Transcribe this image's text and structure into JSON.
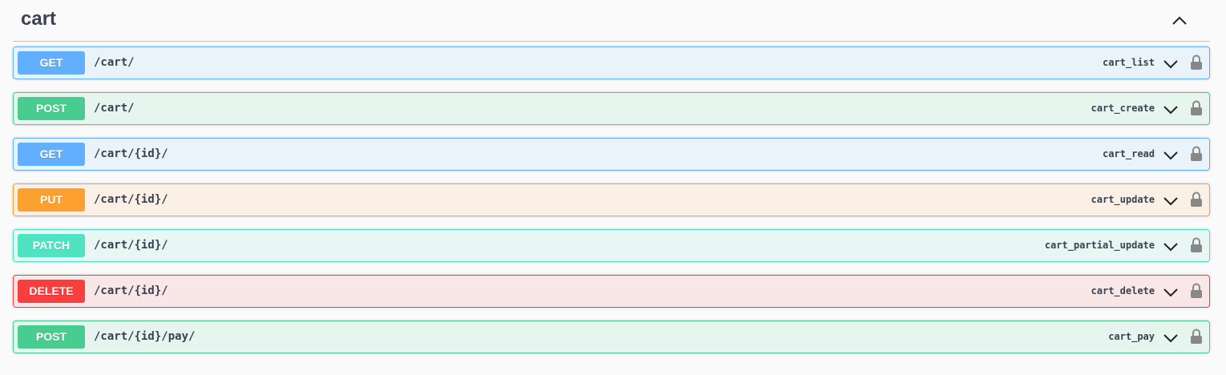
{
  "section": {
    "title": "cart"
  },
  "operations": [
    {
      "method": "GET",
      "path": "/cart/",
      "operation_id": "cart_list"
    },
    {
      "method": "POST",
      "path": "/cart/",
      "operation_id": "cart_create"
    },
    {
      "method": "GET",
      "path": "/cart/{id}/",
      "operation_id": "cart_read"
    },
    {
      "method": "PUT",
      "path": "/cart/{id}/",
      "operation_id": "cart_update"
    },
    {
      "method": "PATCH",
      "path": "/cart/{id}/",
      "operation_id": "cart_partial_update"
    },
    {
      "method": "DELETE",
      "path": "/cart/{id}/",
      "operation_id": "cart_delete"
    },
    {
      "method": "POST",
      "path": "/cart/{id}/pay/",
      "operation_id": "cart_pay"
    }
  ],
  "icons": {
    "section_toggle": "chevron-up-icon",
    "expand": "chevron-down-icon",
    "auth": "lock-icon"
  },
  "colors": {
    "GET": "#61affe",
    "POST": "#49cc90",
    "PUT": "#fca130",
    "PATCH": "#50e3c2",
    "DELETE": "#f93e3e"
  }
}
